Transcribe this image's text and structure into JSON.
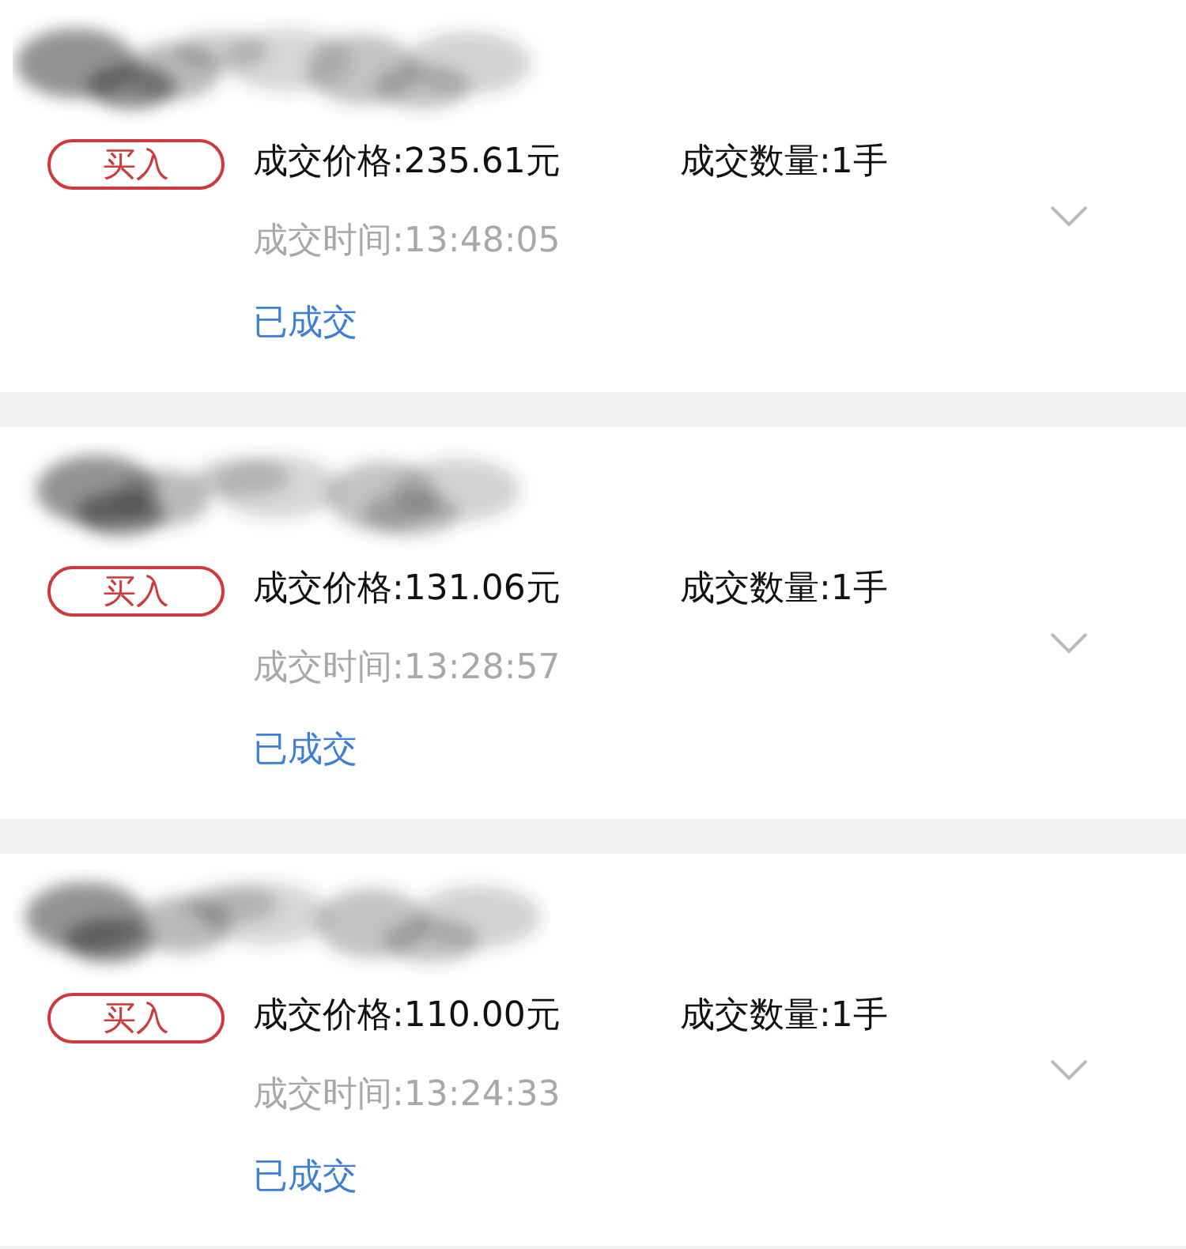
{
  "orders": [
    {
      "side": "买入",
      "price": "成交价格:235.61元",
      "quantity": "成交数量:1手",
      "time": "成交时间:13:48:05",
      "status": "已成交"
    },
    {
      "side": "买入",
      "price": "成交价格:131.06元",
      "quantity": "成交数量:1手",
      "time": "成交时间:13:28:57",
      "status": "已成交"
    },
    {
      "side": "买入",
      "price": "成交价格:110.00元",
      "quantity": "成交数量:1手",
      "time": "成交时间:13:24:33",
      "status": "已成交"
    }
  ]
}
